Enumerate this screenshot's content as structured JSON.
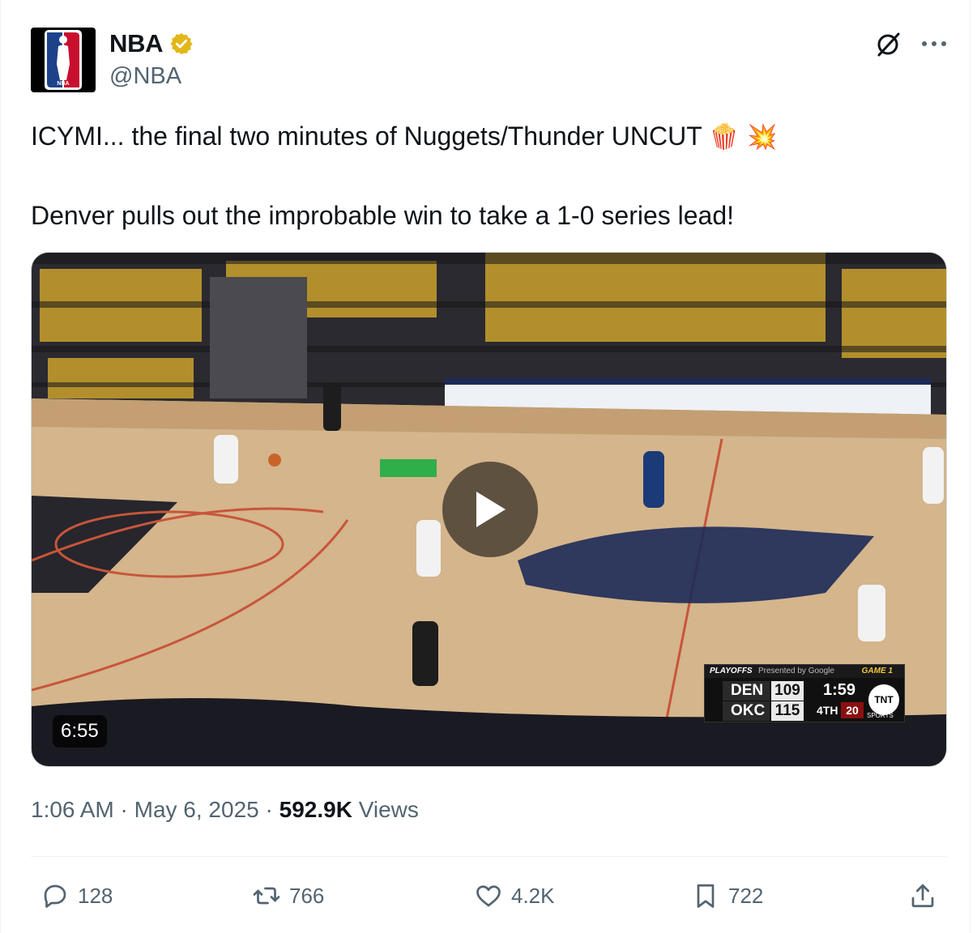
{
  "author": {
    "name": "NBA",
    "handle": "@NBA",
    "avatar_icon": "nba-logo-icon",
    "verified_badge_color": "#e2b719"
  },
  "tweet": {
    "line1": "ICYMI... the final two minutes of Nuggets/Thunder UNCUT",
    "line1_emojis": "🍿 💥",
    "line2": "Denver pulls out the improbable win to take a 1-0 series lead!"
  },
  "video": {
    "duration": "6:55",
    "scorebug": {
      "series_label": "PLAYOFFS",
      "sponsor": "Presented by Google",
      "game_label": "GAME 1",
      "team1": "DEN",
      "team1_score": "109",
      "team2": "OKC",
      "team2_score": "115",
      "clock": "1:59",
      "period": "4TH",
      "shot_clock": "20",
      "network": "TNT",
      "network_sub": "SPORTS"
    }
  },
  "meta": {
    "time": "1:06 AM",
    "separator": "·",
    "date": "May 6, 2025",
    "views_count": "592.9K",
    "views_label": "Views"
  },
  "actions": {
    "replies": "128",
    "reposts": "766",
    "likes": "4.2K",
    "bookmarks": "722"
  },
  "colors": {
    "text_primary": "#0f1419",
    "text_secondary": "#536471",
    "border": "#cfd9de"
  }
}
